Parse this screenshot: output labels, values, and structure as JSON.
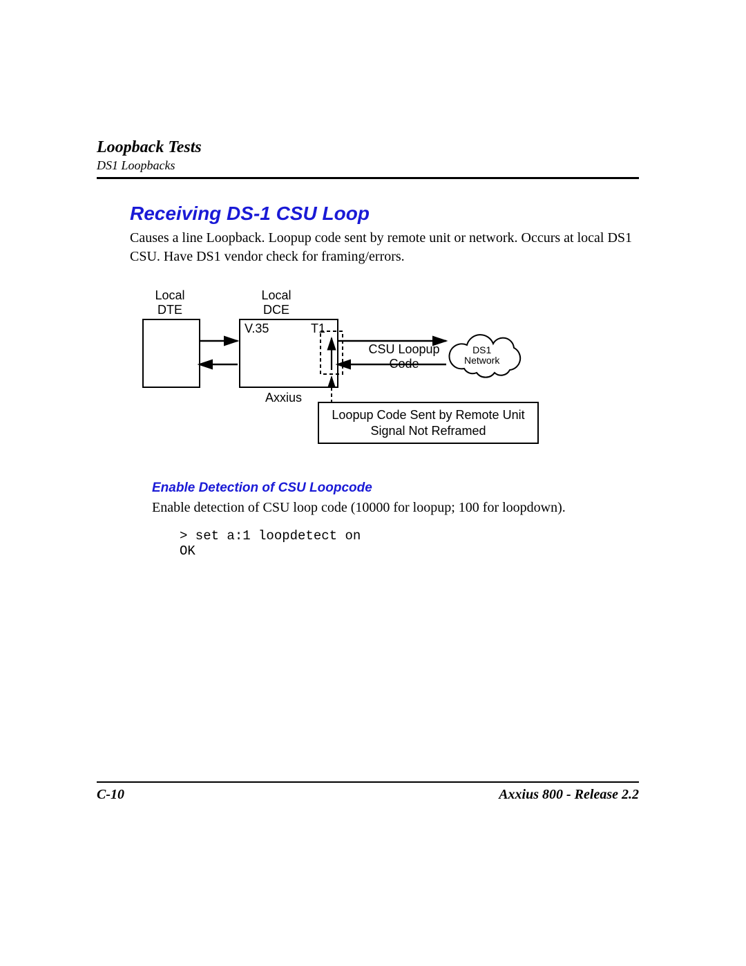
{
  "header": {
    "title": "Loopback Tests",
    "subtitle": "DS1 Loopbacks"
  },
  "section": {
    "title": "Receiving DS-1 CSU Loop",
    "body": "Causes a line Loopback. Loopup code sent by remote unit or network. Occurs at local DS1 CSU. Have DS1 vendor check for framing/errors."
  },
  "diagram": {
    "local_dte_top": "Local",
    "local_dte_bot": "DTE",
    "local_dce_top": "Local",
    "local_dce_bot": "DCE",
    "v35": "V.35",
    "t1": "T1",
    "axxius": "Axxius",
    "csu_loopup_top": "CSU Loopup",
    "csu_loopup_bot": "Code",
    "cloud_top": "DS1",
    "cloud_bot": "Network",
    "legend_l1": "Loopup Code Sent by Remote Unit",
    "legend_l2": "Signal Not Reframed"
  },
  "subsection": {
    "title": "Enable Detection of CSU Loopcode",
    "body": "Enable detection of CSU loop code (10000 for loopup; 100 for loopdown).",
    "code": "> set a:1 loopdetect on\nOK"
  },
  "footer": {
    "left": "C-10",
    "right": "Axxius 800 - Release 2.2"
  }
}
